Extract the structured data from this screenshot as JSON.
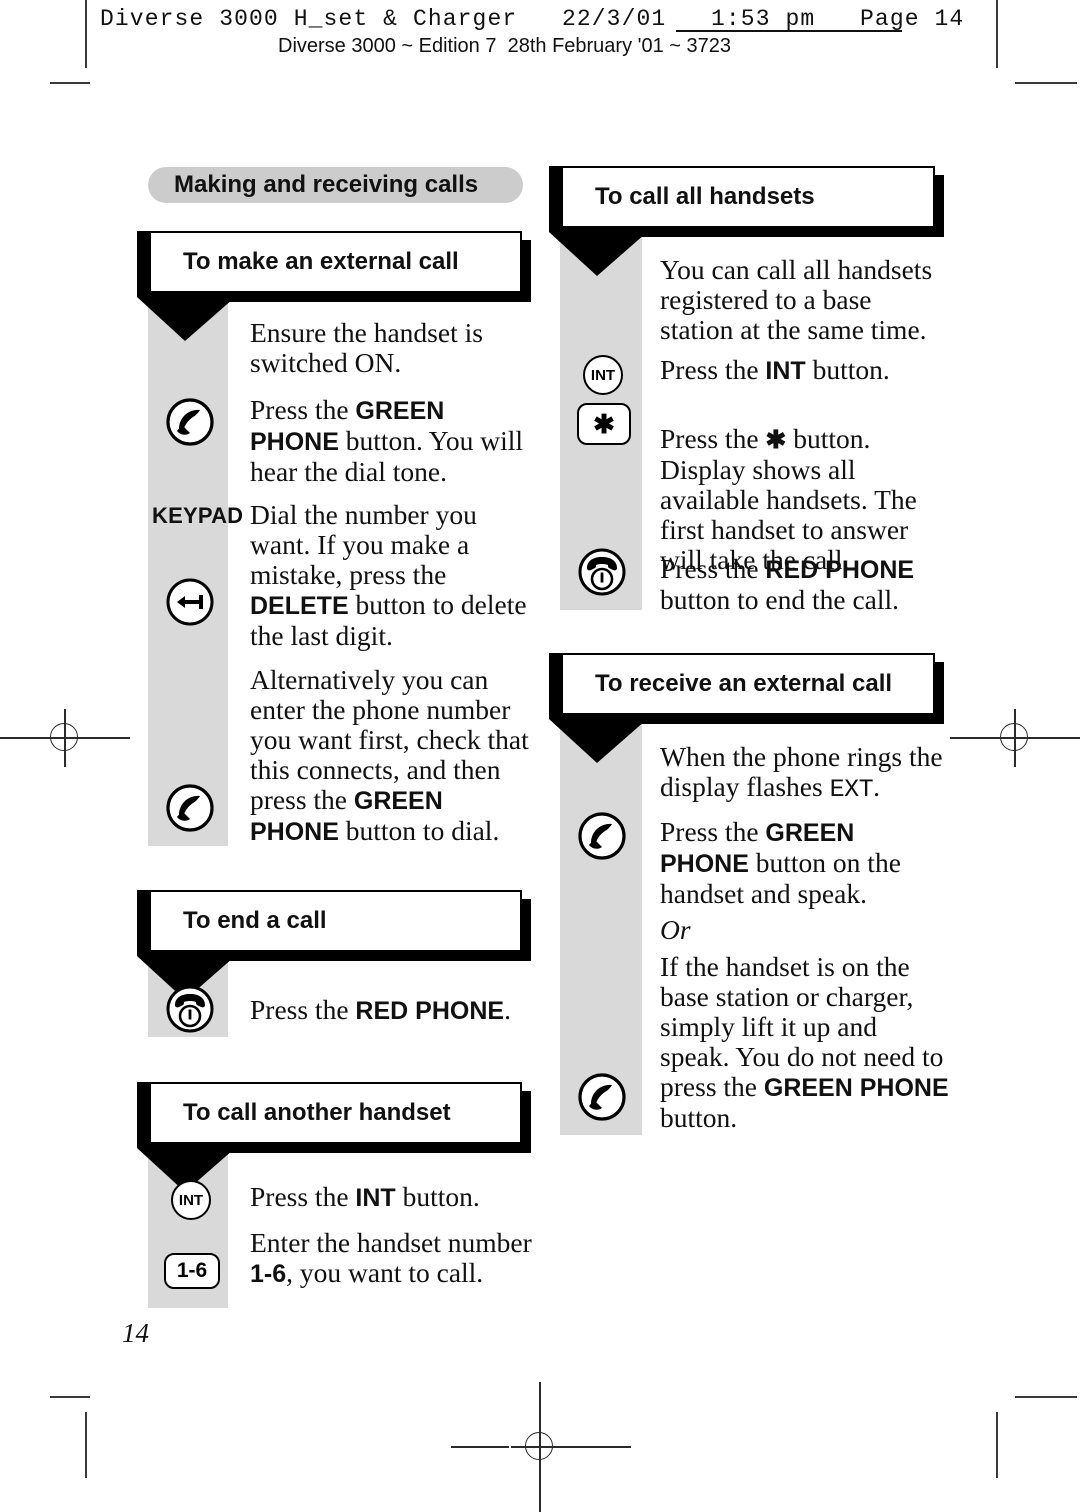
{
  "print_slug": {
    "line1": "Diverse 3000 H_set & Charger   22/3/01   1:53 pm   Page 14",
    "line2": "Diverse 3000 ~ Edition 7  28th February '01 ~ 3723"
  },
  "page_number": "14",
  "section_header": "Making and receiving calls",
  "left_column": {
    "sections": [
      {
        "heading": "To make an external call",
        "steps": [
          {
            "icon": "none",
            "icon_label": "",
            "text_html": "Ensure the handset is switched ON."
          },
          {
            "icon": "green-phone",
            "icon_label": "",
            "text_html": "Press the <b>GREEN PHONE</b> button. You will hear the dial tone."
          },
          {
            "icon": "keypad-text",
            "icon_label": "KEYPAD",
            "text_html": "Dial the number you want. If you make a mistake, press the <b>DELETE</b> button to delete the last digit."
          },
          {
            "icon": "delete-arrow",
            "icon_label": "",
            "text_html": ""
          },
          {
            "icon": "green-phone",
            "icon_label": "",
            "text_html": "Alternatively you can enter the phone number you want first, check that this connects, and then press the <b>GREEN PHONE</b> button to dial."
          }
        ]
      },
      {
        "heading": "To end a call",
        "steps": [
          {
            "icon": "red-phone",
            "icon_label": "",
            "text_html": "Press the <b>RED PHONE</b>."
          }
        ]
      },
      {
        "heading": "To call another handset",
        "steps": [
          {
            "icon": "int-button",
            "icon_label": "INT",
            "text_html": "Press the <b>INT</b> button."
          },
          {
            "icon": "key-1-6",
            "icon_label": "1-6",
            "text_html": "Enter the handset number <b>1-6</b>, you want to call."
          }
        ]
      }
    ]
  },
  "right_column": {
    "sections": [
      {
        "heading": "To call all handsets",
        "steps": [
          {
            "icon": "none",
            "icon_label": "",
            "text_html": "You can call all handsets registered to a base station at the same time."
          },
          {
            "icon": "int-button",
            "icon_label": "INT",
            "text_html": "Press the <b>INT</b> button."
          },
          {
            "icon": "star-button",
            "icon_label": "✱",
            "text_html": "Press the <b>✱</b> button. Display shows all available handsets. The first handset to answer will take the call."
          },
          {
            "icon": "red-phone",
            "icon_label": "",
            "text_html": "Press the <b>RED PHONE</b> button to end the call."
          }
        ]
      },
      {
        "heading": "To receive an external call",
        "steps": [
          {
            "icon": "none",
            "icon_label": "",
            "text_html": "When the phone rings the display flashes <span class=\"lcd\">EXT</span>."
          },
          {
            "icon": "green-phone",
            "icon_label": "",
            "text_html": "Press the <b>GREEN PHONE</b> button on the handset and speak."
          },
          {
            "icon": "none",
            "icon_label": "",
            "text_html": "<i>Or</i>"
          },
          {
            "icon": "green-phone",
            "icon_label": "",
            "text_html": "If the handset is on the base station or charger, simply lift it up and speak. You do not need to press the <b>GREEN PHONE</b> button."
          }
        ]
      }
    ]
  },
  "icon_names": {
    "green_phone": "green-phone-icon",
    "red_phone": "red-phone-icon",
    "delete": "delete-backspace-icon",
    "int": "int-button-icon",
    "star": "star-button-icon",
    "key_1_6": "handset-number-key-icon",
    "keypad": "keypad-label"
  },
  "colors": {
    "rail_gray": "#d9d9d9",
    "pill_gray": "#cccccc",
    "ink": "#111111"
  }
}
